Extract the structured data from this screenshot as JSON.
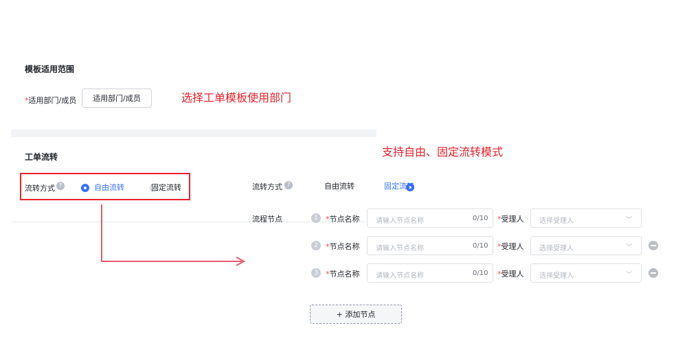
{
  "left_form": {
    "scope_section": {
      "title": "模板适用范围",
      "field_label": "适用部门/成员",
      "button_label": "适用部门/成员"
    },
    "flow_section": {
      "title": "工单流转",
      "mode_label": "流转方式",
      "options": [
        {
          "label": "自由流转",
          "selected": true
        },
        {
          "label": "固定流转",
          "selected": false
        }
      ]
    }
  },
  "annotations": {
    "scope": "选择工单模板使用部门",
    "flow": "支持自由、固定流转模式"
  },
  "right_form": {
    "mode_label": "流转方式",
    "options": [
      {
        "label": "自由流转",
        "selected": false
      },
      {
        "label": "固定流转",
        "selected": true
      }
    ],
    "nodes_label": "流程节点",
    "nodes": [
      {
        "index": "1",
        "name_label": "节点名称",
        "name_placeholder": "请输入节点名称",
        "counter": "0/10",
        "assignee_label": "受理人",
        "assignee_placeholder": "选择受理人",
        "removable": false
      },
      {
        "index": "2",
        "name_label": "节点名称",
        "name_placeholder": "请输入节点名称",
        "counter": "0/10",
        "assignee_label": "受理人",
        "assignee_placeholder": "选择受理人",
        "removable": true
      },
      {
        "index": "3",
        "name_label": "节点名称",
        "name_placeholder": "请输入节点名称",
        "counter": "0/10",
        "assignee_label": "受理人",
        "assignee_placeholder": "选择受理人",
        "removable": true
      }
    ],
    "add_node_label": "+ 添加节点"
  },
  "colors": {
    "accent": "#3370ff",
    "annotation": "#e8212a",
    "arrow": "#e8586f"
  }
}
